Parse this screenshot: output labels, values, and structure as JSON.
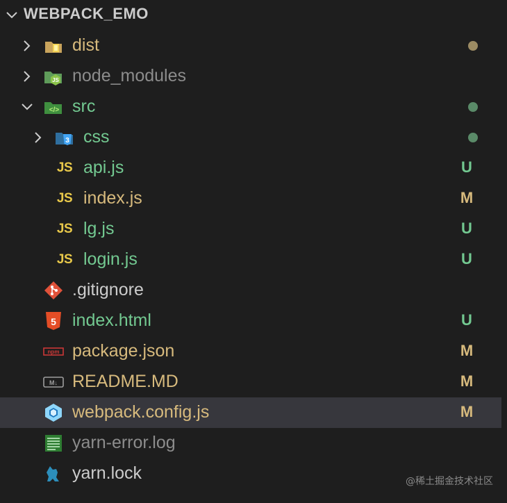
{
  "explorer": {
    "title": "WEBPACK_EMO",
    "expanded": true
  },
  "colors": {
    "background": "#1e1e1e",
    "selected_row": "#37373d",
    "modified": "#d7ba7d",
    "untracked": "#73c991",
    "ignored": "#8c8c8c",
    "default_text": "#cccccc"
  },
  "rows": [
    {
      "label": "dist",
      "icon": "folder-dist-icon",
      "status": "",
      "dot": "#9c8b63",
      "color": "#d7ba7d",
      "twisty": "collapsed",
      "depth": 0
    },
    {
      "label": "node_modules",
      "icon": "folder-node-icon",
      "status": "",
      "dot": "",
      "color": "#8c8c8c",
      "twisty": "collapsed",
      "depth": 0
    },
    {
      "label": "src",
      "icon": "folder-src-icon",
      "status": "",
      "dot": "#5a8a68",
      "color": "#73c991",
      "twisty": "expanded",
      "depth": 0
    },
    {
      "label": "css",
      "icon": "folder-css-icon",
      "status": "",
      "dot": "#5a8a68",
      "color": "#73c991",
      "twisty": "collapsed",
      "depth": 1
    },
    {
      "label": "api.js",
      "icon": "javascript-icon",
      "status": "U",
      "dot": "",
      "color": "#73c991",
      "twisty": "",
      "depth": 1
    },
    {
      "label": "index.js",
      "icon": "javascript-icon",
      "status": "M",
      "dot": "",
      "color": "#d7ba7d",
      "twisty": "",
      "depth": 1
    },
    {
      "label": "lg.js",
      "icon": "javascript-icon",
      "status": "U",
      "dot": "",
      "color": "#73c991",
      "twisty": "",
      "depth": 1
    },
    {
      "label": "login.js",
      "icon": "javascript-icon",
      "status": "U",
      "dot": "",
      "color": "#73c991",
      "twisty": "",
      "depth": 1
    },
    {
      "label": ".gitignore",
      "icon": "git-icon",
      "status": "",
      "dot": "",
      "color": "#cccccc",
      "twisty": "",
      "depth": 0
    },
    {
      "label": "index.html",
      "icon": "html5-icon",
      "status": "U",
      "dot": "",
      "color": "#73c991",
      "twisty": "",
      "depth": 0
    },
    {
      "label": "package.json",
      "icon": "npm-icon",
      "status": "M",
      "dot": "",
      "color": "#d7ba7d",
      "twisty": "",
      "depth": 0
    },
    {
      "label": "README.MD",
      "icon": "markdown-icon",
      "status": "M",
      "dot": "",
      "color": "#d7ba7d",
      "twisty": "",
      "depth": 0
    },
    {
      "label": "webpack.config.js",
      "icon": "webpack-icon",
      "status": "M",
      "dot": "",
      "color": "#d7ba7d",
      "twisty": "",
      "depth": 0,
      "selected": true
    },
    {
      "label": "yarn-error.log",
      "icon": "log-icon",
      "status": "",
      "dot": "",
      "color": "#8c8c8c",
      "twisty": "",
      "depth": 0
    },
    {
      "label": "yarn.lock",
      "icon": "yarn-icon",
      "status": "",
      "dot": "",
      "color": "#cccccc",
      "twisty": "",
      "depth": 0
    }
  ],
  "watermark": "@稀土掘金技术社区"
}
